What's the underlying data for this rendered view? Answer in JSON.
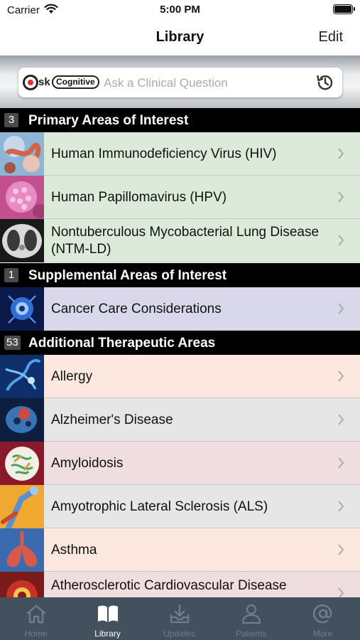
{
  "status_bar": {
    "carrier": "Carrier",
    "time": "5:00 PM"
  },
  "nav": {
    "title": "Library",
    "edit_label": "Edit"
  },
  "search": {
    "logo_prefix": "sk",
    "logo_badge": "Cognitive",
    "placeholder": "Ask a Clinical Question"
  },
  "sections": [
    {
      "count": "3",
      "title": "Primary Areas of Interest",
      "items": [
        {
          "label": "Human Immunodeficiency Virus (HIV)"
        },
        {
          "label": "Human Papillomavirus (HPV)"
        },
        {
          "label": "Nontuberculous Mycobacterial Lung Disease (NTM-LD)"
        }
      ]
    },
    {
      "count": "1",
      "title": "Supplemental Areas of Interest",
      "items": [
        {
          "label": "Cancer Care Considerations"
        }
      ]
    },
    {
      "count": "53",
      "title": "Additional Therapeutic Areas",
      "items": [
        {
          "label": "Allergy"
        },
        {
          "label": "Alzheimer's Disease"
        },
        {
          "label": "Amyloidosis"
        },
        {
          "label": "Amyotrophic Lateral Sclerosis (ALS)"
        },
        {
          "label": "Asthma"
        },
        {
          "label": "Atherosclerotic Cardiovascular Disease"
        }
      ]
    }
  ],
  "tabbar": {
    "tabs": [
      {
        "label": "Home",
        "icon": "home-icon"
      },
      {
        "label": "Library",
        "icon": "book-icon"
      },
      {
        "label": "Updates",
        "icon": "download-tray-icon"
      },
      {
        "label": "Patients",
        "icon": "person-icon"
      },
      {
        "label": "More",
        "icon": "at-icon"
      }
    ],
    "active": "Library"
  },
  "colors": {
    "primary_row": "#dcebd9",
    "supplemental_row": "#d9d8ea",
    "tab_bar": "#43505e"
  }
}
